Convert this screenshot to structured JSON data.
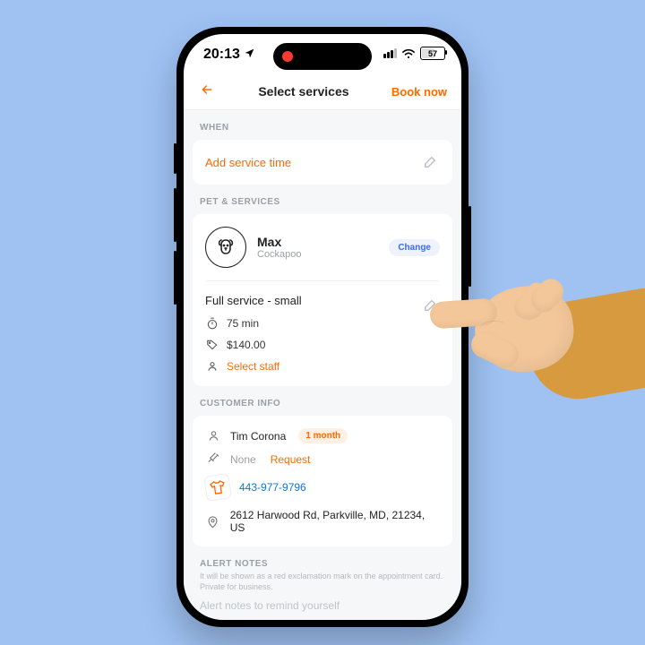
{
  "status": {
    "time": "20:13",
    "battery": "57"
  },
  "nav": {
    "title": "Select services",
    "action": "Book now"
  },
  "sections": {
    "when": {
      "label": "WHEN",
      "add_time": "Add service time"
    },
    "pets": {
      "label": "PET & SERVICES",
      "pet": {
        "name": "Max",
        "breed": "Cockapoo"
      },
      "change": "Change",
      "service": {
        "name": "Full service - small",
        "duration": "75 min",
        "price": "$140.00",
        "select_staff": "Select staff"
      }
    },
    "customer": {
      "label": "CUSTOMER INFO",
      "name": "Tim Corona",
      "recency": "1 month",
      "vaccine_status": "None",
      "vaccine_action": "Request",
      "phone": "443-977-9796",
      "address": "2612 Harwood Rd, Parkville, MD, 21234, US"
    },
    "alert": {
      "label": "ALERT NOTES",
      "sub": "It will be shown as a red exclamation mark on the appointment card. Private for business.",
      "placeholder": "Alert notes to remind yourself"
    }
  }
}
